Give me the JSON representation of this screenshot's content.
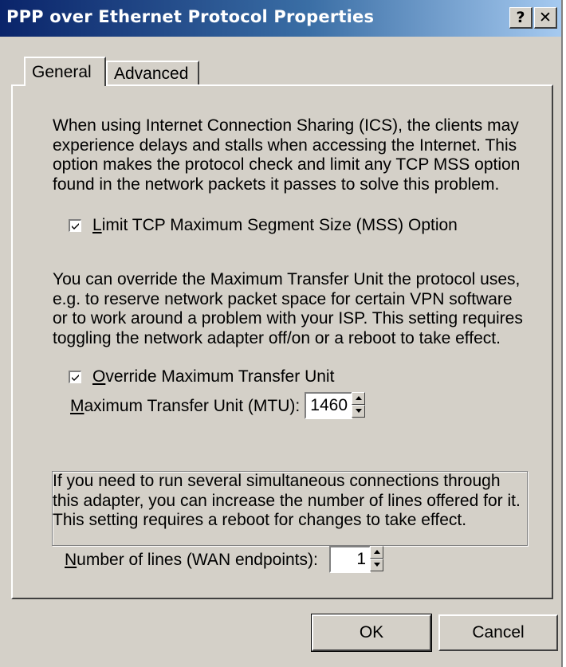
{
  "window": {
    "title": "PPP over Ethernet Protocol Properties",
    "help_button": "?",
    "close_button": "✕"
  },
  "tabs": [
    {
      "label": "General",
      "selected": true
    },
    {
      "label": "Advanced",
      "selected": false
    }
  ],
  "mss_section": {
    "description": [
      "When using Internet Connection Sharing (ICS), the clients may",
      "experience delays and stalls when accessing the Internet. This",
      "option makes the protocol check and limit any TCP MSS option",
      "found in the network packets it passes to solve this problem."
    ],
    "checkbox": {
      "mnemonic": "L",
      "label_rest": "imit TCP Maximum Segment Size (MSS) Option",
      "checked": true
    }
  },
  "mtu_section": {
    "description": [
      "You can override the Maximum Transfer Unit the protocol uses,",
      "e.g. to reserve network packet space for certain VPN software",
      "or to work around a problem with your ISP. This setting requires",
      "toggling the network adapter off/on or a reboot to take effect."
    ],
    "override_checkbox": {
      "mnemonic": "O",
      "label_rest": "verride Maximum Transfer Unit",
      "checked": true
    },
    "mtu_field": {
      "mnemonic": "M",
      "label_rest": "aximum Transfer Unit (MTU):",
      "value": "1460"
    }
  },
  "lines_section": {
    "description": [
      "If you need to run several simultaneous connections through",
      "this adapter, you can increase the number of lines offered for it.",
      "This setting requires a reboot for changes to take effect."
    ],
    "lines_field": {
      "mnemonic": "N",
      "label_rest": "umber of lines (WAN endpoints):",
      "value": "1"
    }
  },
  "buttons": {
    "ok": "OK",
    "cancel": "Cancel"
  },
  "colors": {
    "dialog_face": "#d4d0c8",
    "title_start": "#0a246a",
    "title_end": "#a6caf0"
  }
}
